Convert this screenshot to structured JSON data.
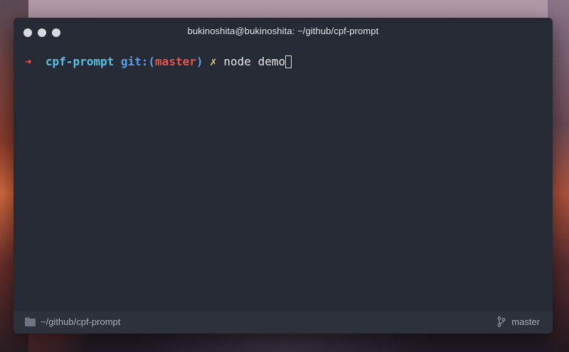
{
  "window": {
    "title": "bukinoshita@bukinoshita: ~/github/cpf-prompt"
  },
  "terminal": {
    "prompt_arrow": "➜",
    "directory": "cpf-prompt",
    "git_label": "git:(",
    "branch": "master",
    "git_close": ")",
    "dirty_marker": "✗",
    "command": "node demo"
  },
  "statusbar": {
    "path": "~/github/cpf-prompt",
    "branch": "master",
    "folder_icon": "folder-icon",
    "branch_icon": "git-branch-icon"
  },
  "colors": {
    "window_bg": "#262a35",
    "statusbar_bg": "#2d313c",
    "arrow": "#e0554c",
    "directory": "#58c0e4",
    "git_label": "#5a9ee8",
    "branch": "#e0554c",
    "dirty": "#e7c46a"
  }
}
